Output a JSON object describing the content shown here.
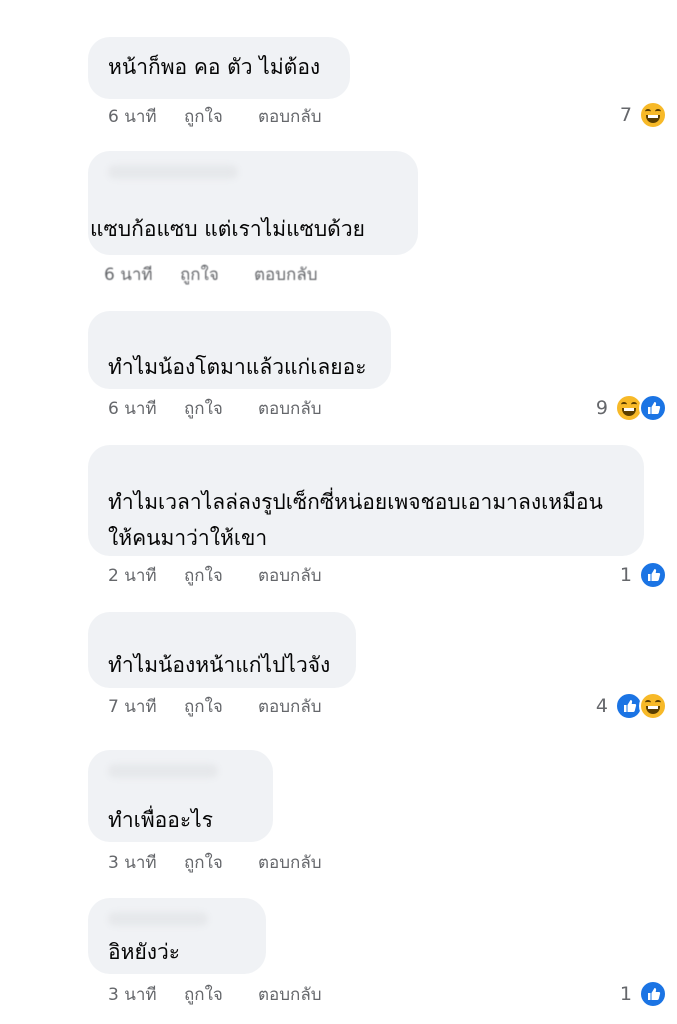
{
  "comments": [
    {
      "text": "หน้าก็พอ คอ ตัว ไม่ต้อง",
      "time": "6 นาที",
      "like_label": "ถูกใจ",
      "reply_label": "ตอบกลับ",
      "reaction_count": "7",
      "reactions": [
        "haha-icon"
      ]
    },
    {
      "text": "แซบก้อแซบ  แต่เราไม่แซบด้วย",
      "time": "6 นาที",
      "like_label": "ถูกใจ",
      "reply_label": "ตอบกลับ",
      "reaction_count": "",
      "reactions": []
    },
    {
      "text": "ทำไมน้องโตมาแล้วแก่เลยอะ",
      "time": "6 นาที",
      "like_label": "ถูกใจ",
      "reply_label": "ตอบกลับ",
      "reaction_count": "9",
      "reactions": [
        "haha-icon",
        "like-icon"
      ]
    },
    {
      "text": "ทำไมเวลาไลล่ลงรูปเซ็กซี่หน่อยเพจชอบเอามาลงเหมือนให้คนมาว่าให้เขา",
      "time": "2 นาที",
      "like_label": "ถูกใจ",
      "reply_label": "ตอบกลับ",
      "reaction_count": "1",
      "reactions": [
        "like-icon"
      ]
    },
    {
      "text": "ทำไมน้องหน้าแก่ไปไวจัง",
      "time": "7 นาที",
      "like_label": "ถูกใจ",
      "reply_label": "ตอบกลับ",
      "reaction_count": "4",
      "reactions": [
        "like-icon",
        "haha-icon"
      ]
    },
    {
      "text": "ทำเพื่ออะไร",
      "time": "3 นาที",
      "like_label": "ถูกใจ",
      "reply_label": "ตอบกลับ",
      "reaction_count": "",
      "reactions": []
    },
    {
      "text": "อิหยังว่ะ",
      "time": "3 นาที",
      "like_label": "ถูกใจ",
      "reply_label": "ตอบกลับ",
      "reaction_count": "1",
      "reactions": [
        "like-icon"
      ]
    }
  ],
  "colors": {
    "bubble_bg": "#f0f2f5",
    "meta_text": "#65676b",
    "like_blue": "#1b74e4",
    "haha_yellow": "#f7b928"
  }
}
